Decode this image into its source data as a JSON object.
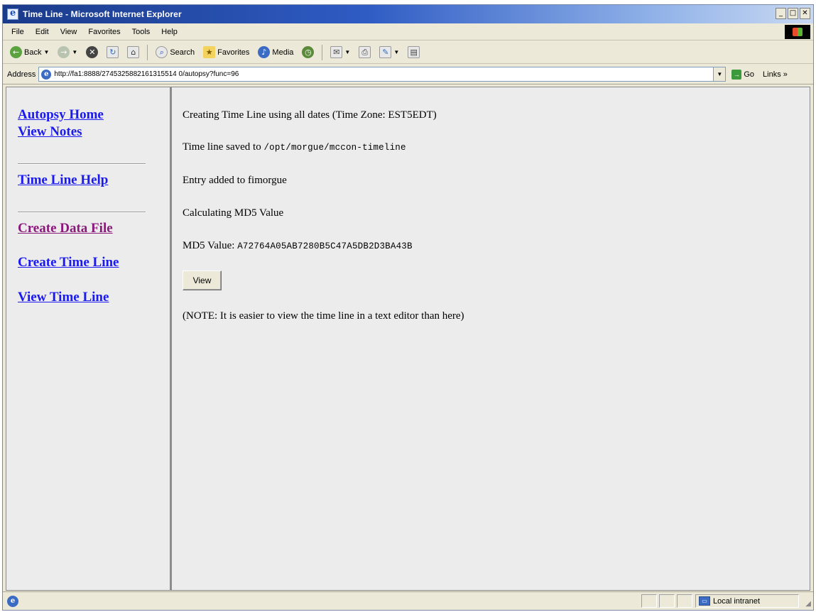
{
  "window": {
    "title": "Time Line - Microsoft Internet Explorer",
    "controls": {
      "minimize": "_",
      "maximize": "□",
      "close": "✕"
    }
  },
  "menu": [
    "File",
    "Edit",
    "View",
    "Favorites",
    "Tools",
    "Help"
  ],
  "toolbar": {
    "back_label": "Back",
    "search_label": "Search",
    "favorites_label": "Favorites",
    "media_label": "Media"
  },
  "address": {
    "label": "Address",
    "url": "http://fa1:8888/2745325882161315514 0/autopsy?func=96",
    "go_label": "Go",
    "links_label": "Links »"
  },
  "nav": {
    "autopsy_home": "Autopsy Home",
    "view_notes": "View Notes",
    "time_line_help": "Time Line Help",
    "create_data_file": "Create Data File",
    "create_time_line": "Create Time Line",
    "view_time_line": "View Time Line"
  },
  "main": {
    "creating": "Creating Time Line using all dates (Time Zone: EST5EDT)",
    "saved_prefix": "Time line saved to",
    "saved_path": "/opt/morgue/mccon-timeline",
    "entry_added": "Entry added to fimorgue",
    "calculating": "Calculating MD5 Value",
    "md5_prefix": "MD5 Value:",
    "md5_value": "A72764A05AB7280B5C47A5DB2D3BA43B",
    "view_button": "View",
    "note": "(NOTE: It is easier to view the time line in a text editor than here)"
  },
  "status": {
    "zone": "Local intranet"
  }
}
